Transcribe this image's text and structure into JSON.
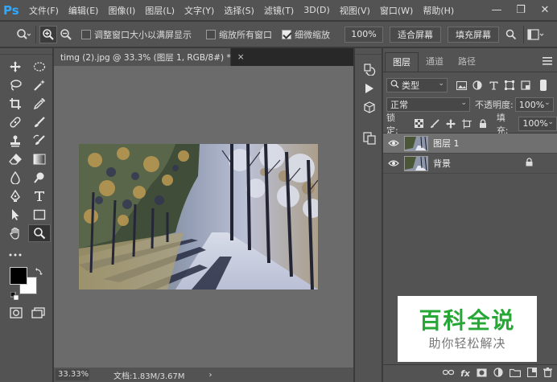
{
  "app": {
    "logo": "Ps"
  },
  "menu": [
    "文件(F)",
    "编辑(E)",
    "图像(I)",
    "图层(L)",
    "文字(Y)",
    "选择(S)",
    "滤镜(T)",
    "3D(D)",
    "视图(V)",
    "窗口(W)",
    "帮助(H)"
  ],
  "window_buttons": {
    "minimize": "—",
    "restore": "❐",
    "close": "✕"
  },
  "options": {
    "resize_windows": "调整窗口大小以满屏显示",
    "zoom_all_windows": "缩放所有窗口",
    "scrubby_zoom": "细微缩放",
    "zoom_value": "100%",
    "fit_screen": "适合屏幕",
    "fill_screen": "填充屏幕"
  },
  "document": {
    "tab_title": "timg (2).jpg @ 33.3% (图层 1, RGB/8#) *",
    "tab_close": "×",
    "status_zoom": "33.33%",
    "status_doc": "文档:1.83M/3.67M",
    "status_arrow": "›"
  },
  "panel": {
    "tabs": [
      "图层",
      "通道",
      "路径"
    ],
    "kind_filter": "类型",
    "blend_mode": "正常",
    "opacity_label": "不透明度:",
    "opacity_value": "100%",
    "lock_label": "锁定:",
    "fill_label": "填充:",
    "fill_value": "100%",
    "layers": [
      {
        "name": "图层 1",
        "selected": true
      },
      {
        "name": "背景",
        "selected": false,
        "locked": true
      }
    ],
    "bottom_icons": [
      "link-icon",
      "fx",
      "mask-icon",
      "adjustment-icon",
      "group-icon",
      "new-layer-icon",
      "trash-icon"
    ],
    "fx_label": "fx"
  },
  "watermark": {
    "title": "百科全说",
    "subtitle": "助你轻松解决"
  },
  "colors": {
    "accent": "#31a8ff",
    "watermark_green": "#27a836"
  }
}
